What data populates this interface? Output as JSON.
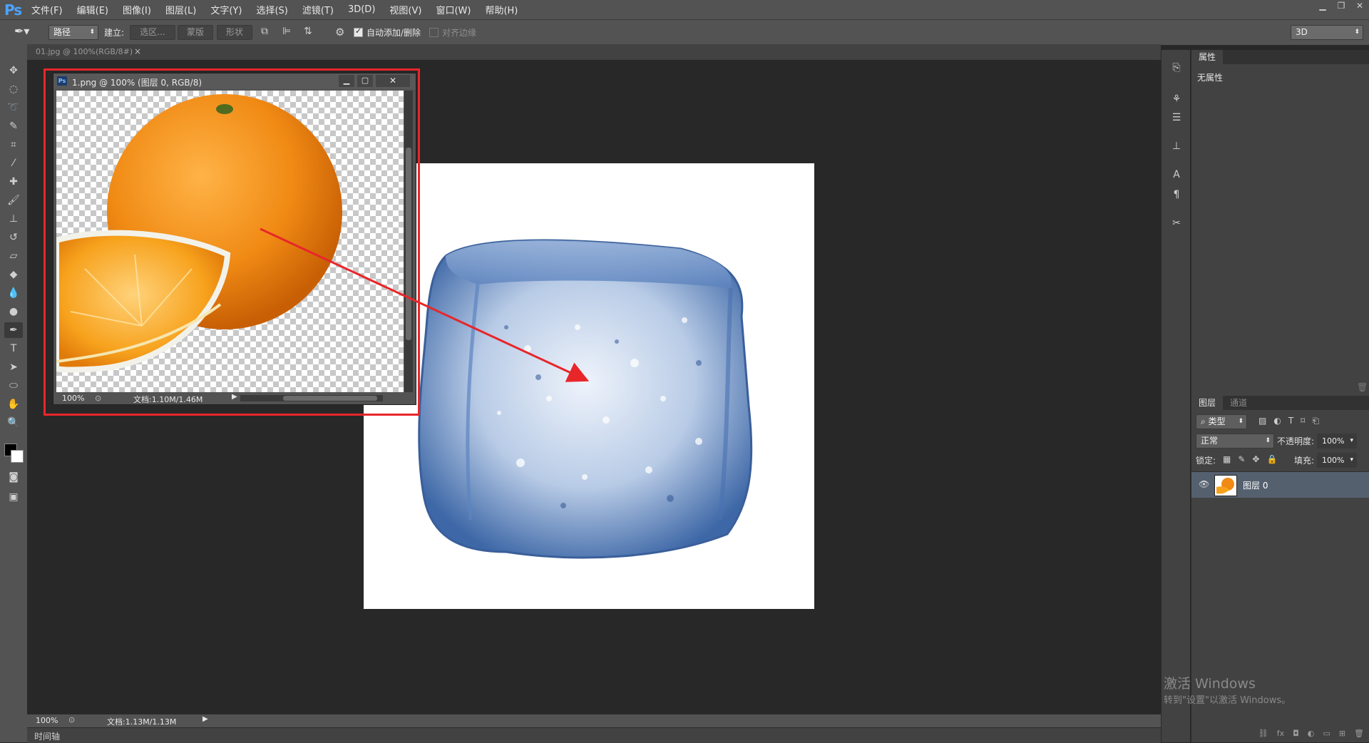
{
  "app": {
    "logo": "Ps"
  },
  "menu": [
    "文件(F)",
    "编辑(E)",
    "图像(I)",
    "图层(L)",
    "文字(Y)",
    "选择(S)",
    "滤镜(T)",
    "3D(D)",
    "视图(V)",
    "窗口(W)",
    "帮助(H)"
  ],
  "options": {
    "mode": "路径",
    "build_label": "建立:",
    "selection_btn": "选区...",
    "mask_btn": "蒙版",
    "shape_btn": "形状",
    "auto_add_delete": "自动添加/删除",
    "align_edges": "对齐边缘",
    "workspace": "3D"
  },
  "document_tab": {
    "title": "01.jpg @ 100%(RGB/8#)",
    "close": "×"
  },
  "floating_window": {
    "title": "1.png @ 100% (图层 0, RGB/8)",
    "zoom": "100%",
    "doc_info": "文档:1.10M/1.46M"
  },
  "status_bar": {
    "zoom": "100%",
    "doc_info": "文档:1.13M/1.13M"
  },
  "timeline_label": "时间轴",
  "properties_panel": {
    "tab": "属性",
    "empty_text": "无属性"
  },
  "layers_panel": {
    "tabs": [
      "图层",
      "通道"
    ],
    "filter_kind": "类型",
    "blend_mode": "正常",
    "opacity_label": "不透明度:",
    "opacity_value": "100%",
    "lock_label": "锁定:",
    "fill_label": "填充:",
    "fill_value": "100%",
    "layers": [
      {
        "name": "图层 0",
        "visible": true
      }
    ]
  },
  "watermark": {
    "line1": "激活 Windows",
    "line2": "转到\"设置\"以激活 Windows。"
  },
  "colors": {
    "annotation_red": "#e8262a",
    "ui_dark": "#535353",
    "canvas_bg": "#282828"
  }
}
